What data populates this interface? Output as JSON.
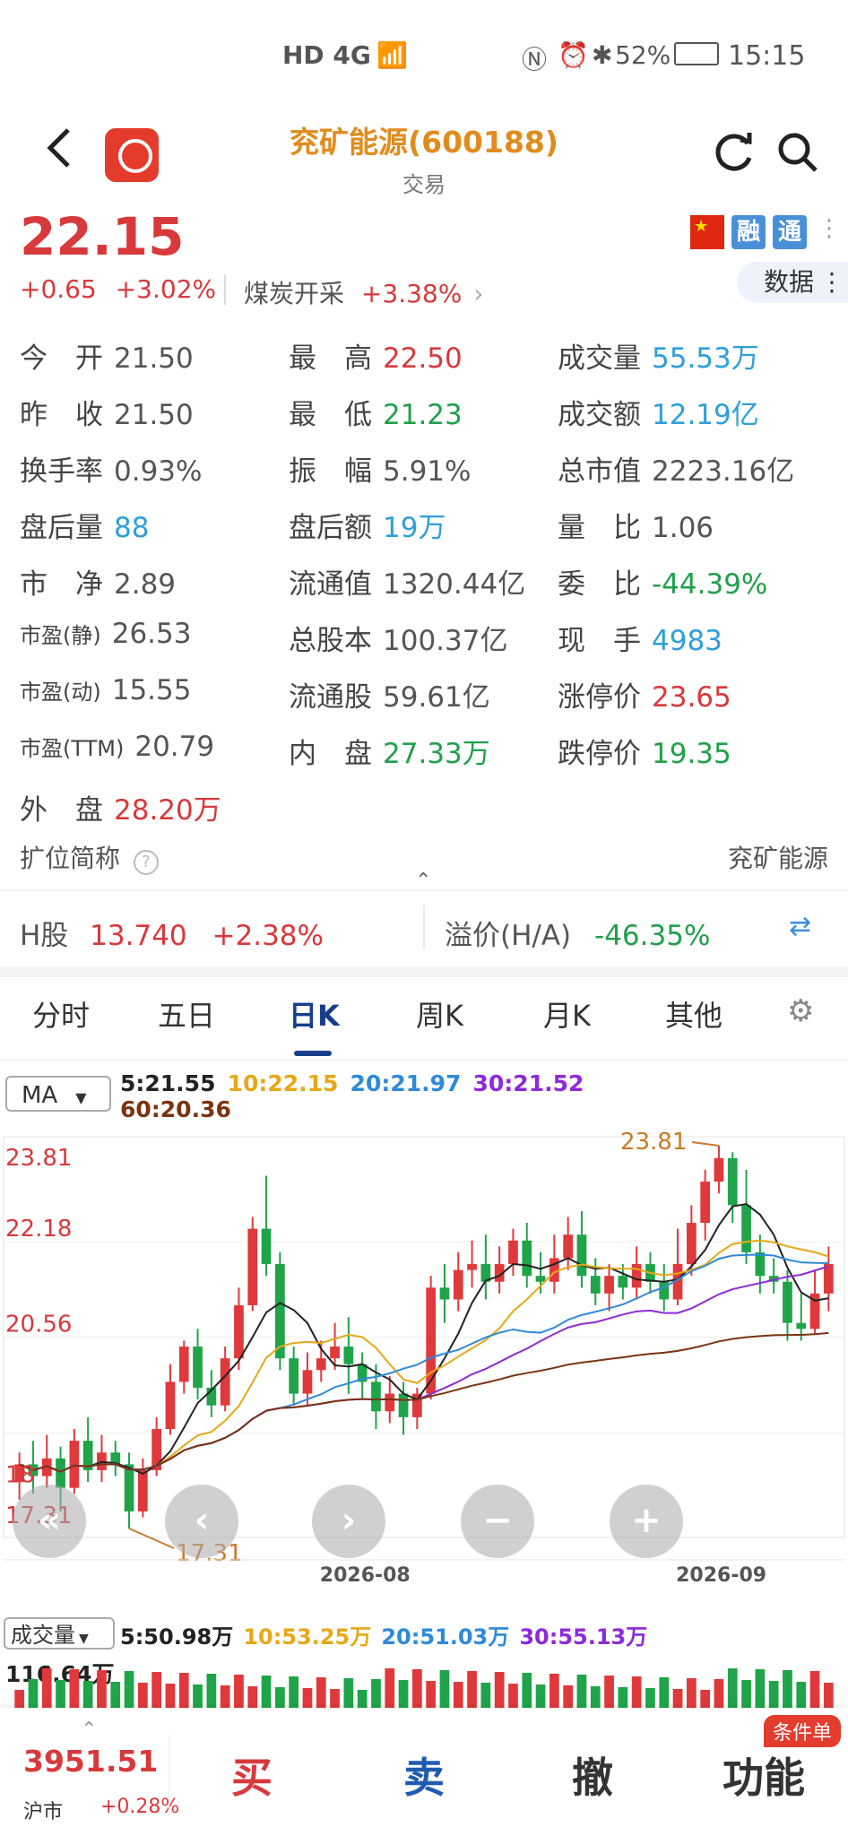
{
  "status_bar": {
    "network": "HD 4G",
    "battery": "52%",
    "time": "15:15"
  },
  "header": {
    "title": "兖矿能源(600188)",
    "subtitle": "交易",
    "back_icon": "chevron-left-icon",
    "refresh_icon": "refresh-icon",
    "search_icon": "search-icon"
  },
  "quote": {
    "price": "22.15",
    "change": "+0.65",
    "change_pct": "+3.02%",
    "sector": "煤炭开采",
    "sector_pct": "+3.38%",
    "badge_rong": "融",
    "badge_tong": "通",
    "data_btn": "数据"
  },
  "grid": [
    [
      {
        "k": "今　开",
        "v": "21.50",
        "c": "gray"
      },
      {
        "k": "最　高",
        "v": "22.50",
        "c": "red"
      },
      {
        "k": "成交量",
        "v": "55.53万",
        "c": "blue"
      }
    ],
    [
      {
        "k": "昨　收",
        "v": "21.50",
        "c": "gray"
      },
      {
        "k": "最　低",
        "v": "21.23",
        "c": "green"
      },
      {
        "k": "成交额",
        "v": "12.19亿",
        "c": "blue"
      }
    ],
    [
      {
        "k": "换手率",
        "v": "0.93%",
        "c": "gray"
      },
      {
        "k": "振　幅",
        "v": "5.91%",
        "c": "gray"
      },
      {
        "k": "总市值",
        "v": "2223.16亿",
        "c": "gray"
      }
    ],
    [
      {
        "k": "盘后量",
        "v": "88",
        "c": "blue"
      },
      {
        "k": "盘后额",
        "v": "19万",
        "c": "blue"
      },
      {
        "k": "量　比",
        "v": "1.06",
        "c": "gray"
      }
    ],
    [
      {
        "k": "市　净",
        "v": "2.89",
        "c": "gray"
      },
      {
        "k": "流通值",
        "v": "1320.44亿",
        "c": "gray"
      },
      {
        "k": "委　比",
        "v": "-44.39%",
        "c": "green"
      }
    ],
    [
      {
        "k": "市盈(静)",
        "v": "26.53",
        "c": "gray"
      },
      {
        "k": "总股本",
        "v": "100.37亿",
        "c": "gray"
      },
      {
        "k": "现　手",
        "v": "4983",
        "c": "blue"
      }
    ],
    [
      {
        "k": "市盈(动)",
        "v": "15.55",
        "c": "gray"
      },
      {
        "k": "流通股",
        "v": "59.61亿",
        "c": "gray"
      },
      {
        "k": "涨停价",
        "v": "23.65",
        "c": "red"
      }
    ],
    [
      {
        "k": "市盈(TTM)",
        "v": "20.79",
        "c": "gray"
      },
      {
        "k": "内　盘",
        "v": "27.33万",
        "c": "green"
      },
      {
        "k": "跌停价",
        "v": "19.35",
        "c": "green"
      }
    ],
    [
      {
        "k": "外　盘",
        "v": "28.20万",
        "c": "red"
      }
    ]
  ],
  "abbr": {
    "label": "扩位简称",
    "value": "兖矿能源"
  },
  "hshare": {
    "label": "H股",
    "price": "13.740",
    "pct": "+2.38%",
    "premium_label": "溢价(H/A)",
    "premium": "-46.35%"
  },
  "tabs": [
    "分时",
    "五日",
    "日K",
    "周K",
    "月K",
    "其他"
  ],
  "ma": {
    "select": "MA",
    "ma5": "5:21.55",
    "ma10": "10:22.15",
    "ma20": "20:21.97",
    "ma30": "30:21.52",
    "ma60": "60:20.36"
  },
  "chart_data": {
    "type": "candlestick",
    "y_ticks": [
      "23.81",
      "22.18",
      "20.56",
      "18",
      "17.31"
    ],
    "ylim": [
      17.31,
      23.81
    ],
    "high_marker": "23.81",
    "low_marker": "17.31",
    "x_ticks": [
      "2026-08",
      "2026-09"
    ],
    "candles": [
      [
        18.1,
        18.4,
        17.8,
        18.6
      ],
      [
        18.4,
        18.2,
        17.9,
        18.8
      ],
      [
        18.2,
        18.5,
        18.0,
        18.9
      ],
      [
        18.5,
        18.0,
        17.6,
        18.7
      ],
      [
        18.0,
        18.8,
        17.9,
        19.0
      ],
      [
        18.8,
        18.3,
        18.1,
        19.2
      ],
      [
        18.3,
        18.6,
        18.1,
        18.9
      ],
      [
        18.6,
        18.4,
        18.2,
        18.8
      ],
      [
        18.4,
        17.6,
        17.31,
        18.6
      ],
      [
        17.6,
        18.3,
        17.5,
        18.5
      ],
      [
        18.3,
        19.0,
        18.2,
        19.2
      ],
      [
        19.0,
        19.8,
        18.9,
        20.1
      ],
      [
        19.8,
        20.4,
        19.6,
        20.5
      ],
      [
        20.4,
        19.7,
        19.5,
        20.7
      ],
      [
        19.7,
        19.4,
        19.2,
        20.0
      ],
      [
        19.4,
        20.2,
        19.3,
        20.4
      ],
      [
        20.2,
        21.1,
        20.0,
        21.4
      ],
      [
        21.1,
        22.4,
        21.0,
        22.6
      ],
      [
        22.4,
        21.8,
        21.6,
        23.3
      ],
      [
        21.8,
        20.2,
        20.0,
        22.0
      ],
      [
        20.2,
        19.6,
        19.4,
        20.4
      ],
      [
        19.6,
        20.0,
        19.4,
        20.3
      ],
      [
        20.0,
        20.2,
        19.8,
        20.5
      ],
      [
        20.2,
        20.4,
        20.0,
        20.8
      ],
      [
        20.4,
        20.1,
        19.6,
        20.9
      ],
      [
        20.1,
        19.8,
        19.5,
        20.3
      ],
      [
        19.8,
        19.3,
        19.0,
        20.1
      ],
      [
        19.3,
        19.6,
        19.1,
        19.9
      ],
      [
        19.6,
        19.2,
        18.9,
        19.8
      ],
      [
        19.2,
        19.6,
        19.0,
        19.7
      ],
      [
        19.6,
        21.4,
        19.5,
        21.6
      ],
      [
        21.4,
        21.2,
        20.8,
        21.8
      ],
      [
        21.2,
        21.7,
        21.0,
        22.0
      ],
      [
        21.7,
        21.8,
        21.4,
        22.2
      ],
      [
        21.8,
        21.5,
        21.2,
        22.3
      ],
      [
        21.5,
        21.8,
        21.3,
        22.1
      ],
      [
        21.8,
        22.2,
        21.6,
        22.4
      ],
      [
        22.2,
        21.6,
        21.4,
        22.5
      ],
      [
        21.6,
        21.5,
        21.3,
        22.0
      ],
      [
        21.5,
        21.9,
        21.3,
        22.3
      ],
      [
        21.9,
        22.3,
        21.7,
        22.6
      ],
      [
        22.3,
        21.6,
        21.4,
        22.7
      ],
      [
        21.6,
        21.3,
        21.1,
        21.9
      ],
      [
        21.3,
        21.6,
        21.0,
        21.8
      ],
      [
        21.6,
        21.4,
        21.2,
        21.8
      ],
      [
        21.4,
        21.8,
        21.2,
        22.1
      ],
      [
        21.8,
        21.5,
        21.3,
        22.0
      ],
      [
        21.5,
        21.2,
        21.0,
        21.8
      ],
      [
        21.2,
        21.8,
        21.1,
        22.4
      ],
      [
        21.8,
        22.5,
        21.6,
        22.8
      ],
      [
        22.5,
        23.2,
        22.2,
        23.4
      ],
      [
        23.2,
        23.6,
        23.0,
        23.81
      ],
      [
        23.6,
        22.8,
        22.5,
        23.7
      ],
      [
        22.8,
        22.0,
        21.8,
        23.4
      ],
      [
        22.0,
        21.6,
        21.3,
        22.3
      ],
      [
        21.6,
        21.5,
        21.3,
        21.9
      ],
      [
        21.5,
        20.8,
        20.5,
        21.7
      ],
      [
        20.8,
        20.7,
        20.5,
        21.3
      ],
      [
        20.7,
        21.3,
        20.6,
        21.7
      ],
      [
        21.3,
        21.8,
        21.0,
        22.1
      ]
    ],
    "vol_label_select": "成交量",
    "vol_ma": {
      "ma5": "5:50.98万",
      "ma10": "10:53.25万",
      "ma20": "20:51.03万",
      "ma30": "30:55.13万"
    },
    "vol_max_label": "116.64万"
  },
  "bottom": {
    "index_value": "3951.51",
    "index_name": "沪市",
    "index_pct": "+0.28%",
    "buy": "买",
    "sell": "卖",
    "cancel": "撤",
    "func": "功能",
    "cond": "条件单"
  }
}
